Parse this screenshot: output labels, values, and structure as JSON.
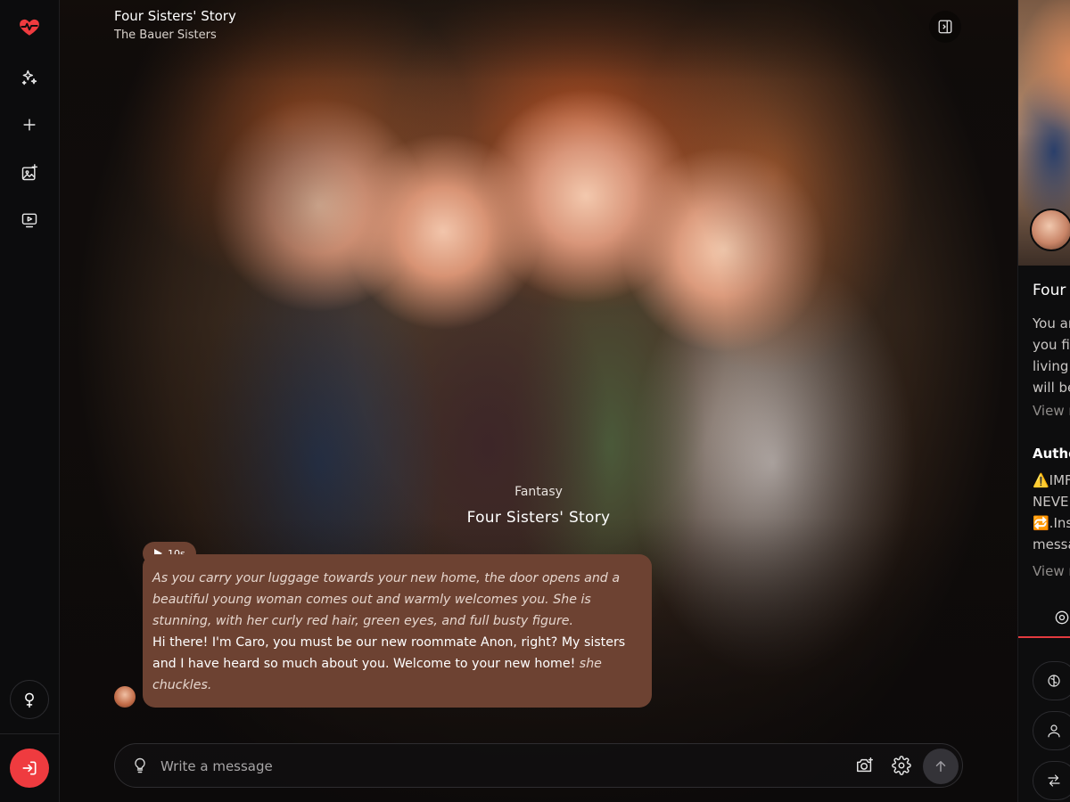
{
  "header": {
    "title": "Four Sisters' Story",
    "subtitle": "The Bauer Sisters"
  },
  "story": {
    "genre": "Fantasy",
    "title": "Four Sisters' Story"
  },
  "message": {
    "audio_duration": "10s",
    "narration": "As you carry your luggage towards your new home, the door opens and a beautiful young woman comes out and warmly welcomes you. She is stunning, with her curly red hair, green eyes, and full busty figure.",
    "speech": "Hi there! I'm Caro, you must be our new roommate Anon, right? My sisters and I have heard so much about you. Welcome to your new home!",
    "action": "she chuckles."
  },
  "composer": {
    "placeholder": "Write a message"
  },
  "side_panel": {
    "name": "Four",
    "description_lines": [
      "You ar",
      "you fi",
      "living",
      "will be"
    ],
    "view_more": "View m",
    "author_label": "Autho",
    "author_note_lines": [
      "⚠️IMF",
      "NEVE",
      "🔁.Ins",
      "messa"
    ],
    "view_more_2": "View m"
  },
  "colors": {
    "accent": "#ef3b3f",
    "bubble": "#6d4232",
    "background": "#0b0b0c"
  },
  "icons": {
    "rail": [
      "heart-pulse-icon",
      "sparkles-icon",
      "plus-icon",
      "image-plus-icon",
      "video-icon"
    ],
    "gender": "female-icon",
    "login": "login-icon"
  }
}
